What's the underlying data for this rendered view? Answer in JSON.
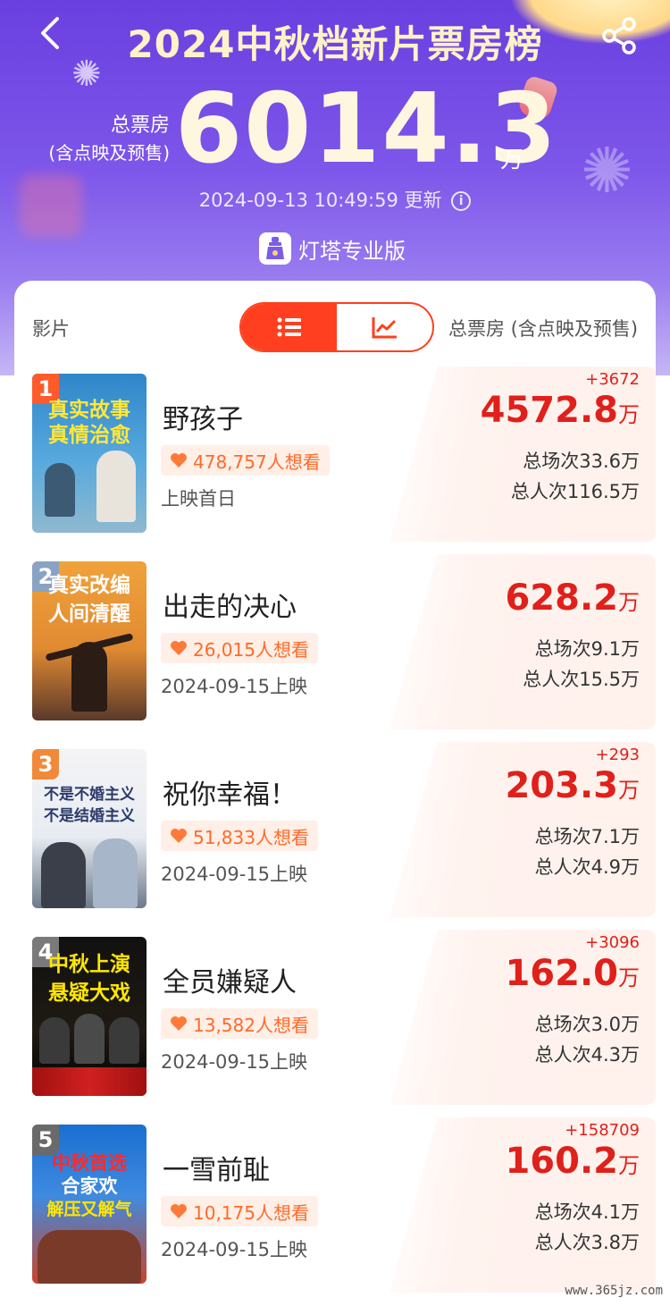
{
  "header": {
    "title": "2024中秋档新片票房榜",
    "total_label_1": "总票房",
    "total_label_2": "(含点映及预售)",
    "total_value": "6014.3",
    "total_unit": "万",
    "update_time": "2024-09-13 10:49:59",
    "update_suffix": "更新",
    "brand": "灯塔专业版"
  },
  "table": {
    "col_film": "影片",
    "col_total": "总票房 (含点映及预售)"
  },
  "films": [
    {
      "rank": "1",
      "name": "野孩子",
      "want": "478,757人想看",
      "release": "上映首日",
      "delta": "+3672",
      "box": "4572.8",
      "unit": "万",
      "shows": "总场次33.6万",
      "people": "总人次116.5万",
      "poster_lines": [
        "真实故事",
        "真情治愈"
      ]
    },
    {
      "rank": "2",
      "name": "出走的决心",
      "want": "26,015人想看",
      "release": "2024-09-15上映",
      "delta": "",
      "box": "628.2",
      "unit": "万",
      "shows": "总场次9.1万",
      "people": "总人次15.5万",
      "poster_lines": [
        "真实改编",
        "人间清醒"
      ]
    },
    {
      "rank": "3",
      "name": "祝你幸福！",
      "want": "51,833人想看",
      "release": "2024-09-15上映",
      "delta": "+293",
      "box": "203.3",
      "unit": "万",
      "shows": "总场次7.1万",
      "people": "总人次4.9万",
      "poster_lines": [
        "不是不婚主义",
        "不是结婚主义"
      ]
    },
    {
      "rank": "4",
      "name": "全员嫌疑人",
      "want": "13,582人想看",
      "release": "2024-09-15上映",
      "delta": "+3096",
      "box": "162.0",
      "unit": "万",
      "shows": "总场次3.0万",
      "people": "总人次4.3万",
      "poster_lines": [
        "中秋上演",
        "悬疑大戏"
      ]
    },
    {
      "rank": "5",
      "name": "一雪前耻",
      "want": "10,175人想看",
      "release": "2024-09-15上映",
      "delta": "+158709",
      "box": "160.2",
      "unit": "万",
      "shows": "总场次4.1万",
      "people": "总人次3.8万",
      "poster_lines": [
        "中秋首选",
        "合家欢",
        "解压又解气"
      ]
    }
  ],
  "watermark": "www.365jz.com",
  "colors": {
    "accent": "#ff3f1f",
    "value_red": "#e0201a",
    "hero_purple": "#6a3fe0"
  }
}
